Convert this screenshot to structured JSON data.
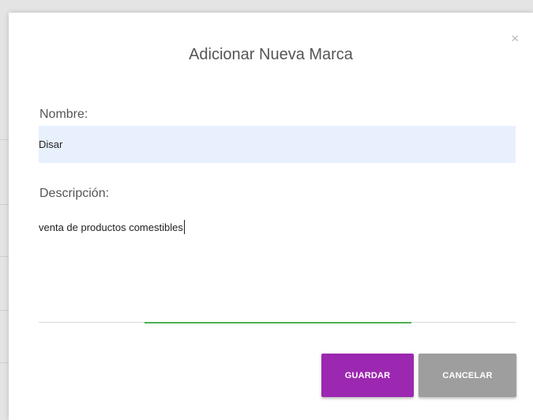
{
  "modal": {
    "title": "Adicionar Nueva Marca",
    "close_icon_glyph": "×",
    "close_icon": "close-icon"
  },
  "form": {
    "nombre_label": "Nombre:",
    "nombre_value": "Disar",
    "descripcion_label": "Descripción:",
    "descripcion_value": "venta de productos comestibles"
  },
  "actions": {
    "save_label": "GUARDAR",
    "cancel_label": "CANCELAR"
  },
  "colors": {
    "save_button": "#9c27b0",
    "cancel_button": "#9e9e9e",
    "focus_underline": "#4caf50",
    "autofill_bg": "#e8f0fe"
  }
}
